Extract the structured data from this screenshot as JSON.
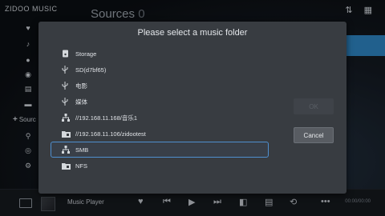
{
  "app": {
    "logo": "ZIDOO MUSIC",
    "page_title": "Sources",
    "source_count": "0"
  },
  "sidebar": {
    "sources_label": "Sourc",
    "plus": "+"
  },
  "dialog": {
    "title": "Please select a music folder",
    "items": [
      {
        "label": "Storage",
        "icon": "storage-icon"
      },
      {
        "label": "SD(d7bf65)",
        "icon": "usb-icon"
      },
      {
        "label": "电影",
        "icon": "usb-icon"
      },
      {
        "label": "媒体",
        "icon": "usb-icon"
      },
      {
        "label": "//192.168.11.168/音乐1",
        "icon": "network-icon"
      },
      {
        "label": "//192.168.11.106/zidootest",
        "icon": "network-folder-icon"
      },
      {
        "label": "SMB",
        "icon": "network-icon",
        "selected": true
      },
      {
        "label": "NFS",
        "icon": "network-folder-icon"
      }
    ],
    "ok_label": "OK",
    "cancel_label": "Cancel"
  },
  "player": {
    "title": "Music Player",
    "time": "00:00/00:00"
  },
  "colors": {
    "accent": "#4f8fd0",
    "dialog_bg": "#383c41",
    "sidebar_highlight": "#2f86c4"
  }
}
